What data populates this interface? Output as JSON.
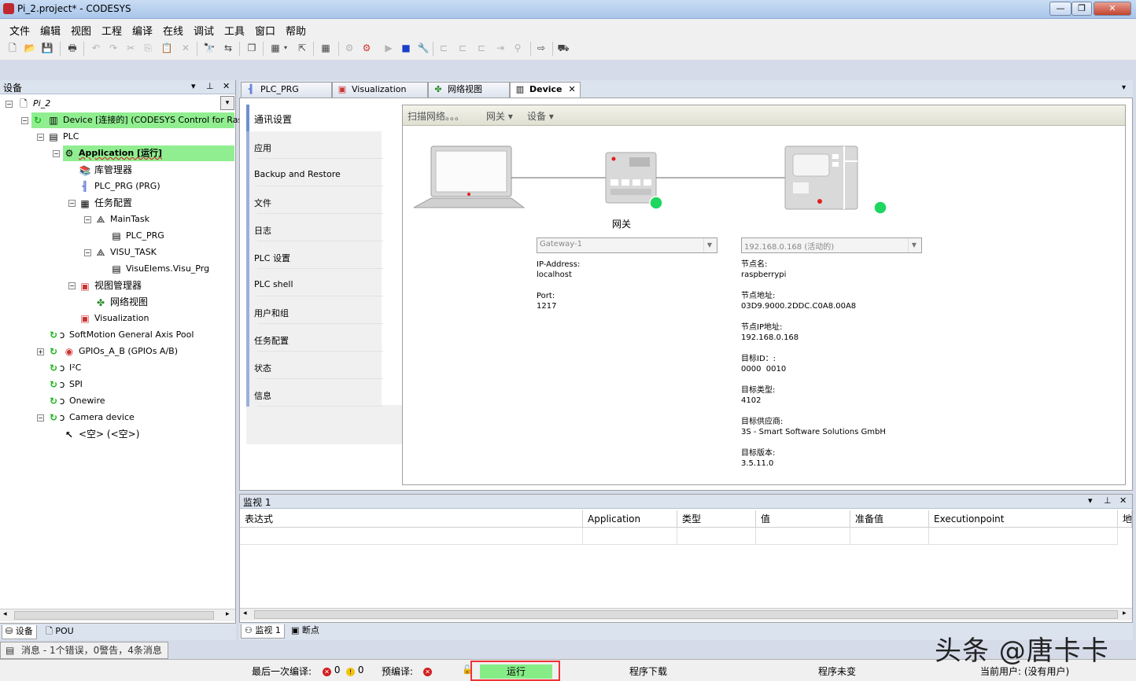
{
  "window": {
    "title": "Pi_2.project* - CODESYS"
  },
  "menu": [
    "文件",
    "编辑",
    "视图",
    "工程",
    "编译",
    "在线",
    "调试",
    "工具",
    "窗口",
    "帮助"
  ],
  "left_panel": {
    "title": "设备",
    "tree": {
      "project": "Pi_2",
      "device": "Device [连接的] (CODESYS Control for Raspb",
      "plc": "PLC",
      "application": "Application [运行]",
      "library_manager": "库管理器",
      "plc_prg": "PLC_PRG (PRG)",
      "task_config": "任务配置",
      "main_task": "MainTask",
      "main_task_call": "PLC_PRG",
      "visu_task": "VISU_TASK",
      "visu_task_call": "VisuElems.Visu_Prg",
      "visu_manager": "视图管理器",
      "network_view": "网络视图",
      "visualization": "Visualization",
      "softmotion": "SoftMotion General Axis Pool",
      "gpios": "GPIOs_A_B (GPIOs A/B)",
      "i2c": "I²C",
      "spi": "SPI",
      "onewire": "Onewire",
      "camera": "Camera device",
      "empty": "<空> (<空>)"
    },
    "bottom_tabs": [
      "设备",
      "POU"
    ]
  },
  "editor_tabs": [
    "PLC_PRG",
    "Visualization",
    "网络视图",
    "Device"
  ],
  "device_editor": {
    "nav": [
      "通讯设置",
      "应用",
      "Backup and Restore",
      "文件",
      "日志",
      "PLC 设置",
      "PLC shell",
      "用户和组",
      "任务配置",
      "状态",
      "信息"
    ],
    "toolbar": [
      "扫描网络。。。",
      "网关 ▾",
      "设备 ▾"
    ],
    "gateway_label": "网关",
    "gateway_combo": "Gateway-1",
    "gateway_info": {
      "ip_label": "IP-Address:",
      "ip_value": "localhost",
      "port_label": "Port:",
      "port_value": "1217"
    },
    "device_combo": "192.168.0.168 (活动的)",
    "device_info": [
      {
        "label": "节点名:",
        "value": "raspberrypi"
      },
      {
        "label": "节点地址:",
        "value": "03D9.9000.2DDC.C0A8.00A8"
      },
      {
        "label": "节点IP地址:",
        "value": "192.168.0.168"
      },
      {
        "label": "目标ID：:",
        "value": "0000  0010"
      },
      {
        "label": "目标类型:",
        "value": "4102"
      },
      {
        "label": "目标供应商:",
        "value": "3S - Smart Software Solutions GmbH"
      },
      {
        "label": "目标版本:",
        "value": "3.5.11.0"
      }
    ]
  },
  "watch": {
    "title": "监视 1",
    "columns": [
      "表达式",
      "Application",
      "类型",
      "值",
      "准备值",
      "Executionpoint",
      "地"
    ],
    "tabs": [
      "监视 1",
      "断点"
    ]
  },
  "messages": "消息 - 1个错误，0警告，4条消息",
  "statusbar": {
    "last_compile": "最后一次编译:",
    "errors": "0",
    "warnings": "0",
    "precompile": "预编译:",
    "run_state": "运行",
    "download": "程序下载",
    "unchanged": "程序未变",
    "user": "当前用户: (没有用户)"
  },
  "watermark": "头条 @唐卡卡",
  "colors": {
    "highlight": "#90ee90",
    "status_run": "#86ed86",
    "status_box": "#ee3333",
    "online_dot": "#1ed760"
  }
}
